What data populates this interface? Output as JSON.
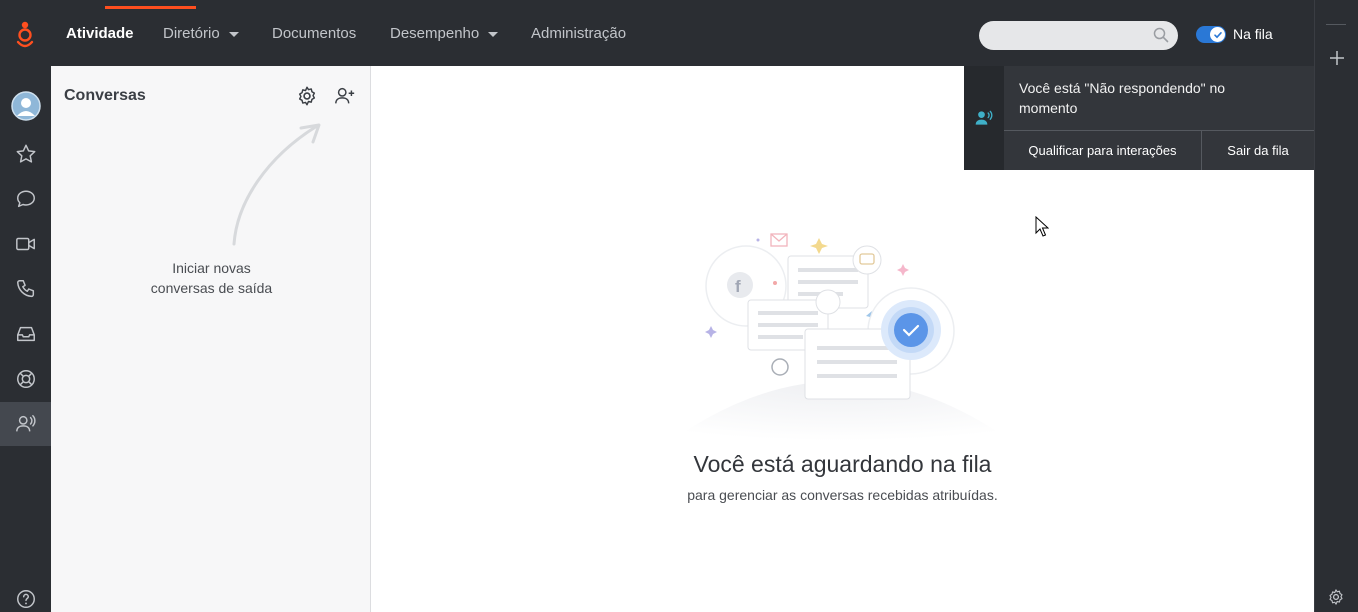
{
  "nav": {
    "items": [
      {
        "label": "Atividade",
        "active": true,
        "dropdown": false
      },
      {
        "label": "Diretório",
        "active": false,
        "dropdown": true
      },
      {
        "label": "Documentos",
        "active": false,
        "dropdown": false
      },
      {
        "label": "Desempenho",
        "active": false,
        "dropdown": true
      },
      {
        "label": "Administração",
        "active": false,
        "dropdown": false
      }
    ],
    "search_placeholder": "",
    "queue_toggle_label": "Na fila"
  },
  "sidebar": {
    "icons": [
      "genesys-logo-icon",
      "avatar-icon",
      "star-icon",
      "chat-icon",
      "video-icon",
      "phone-icon",
      "inbox-icon",
      "lifebuoy-icon",
      "agent-queue-icon",
      "help-icon"
    ]
  },
  "conversations": {
    "title": "Conversas",
    "hint": "Iniciar novas conversas de saída"
  },
  "main": {
    "title": "Você está aguardando na fila",
    "subtitle": "para gerenciar as conversas recebidas atribuídas."
  },
  "notification": {
    "message": "Você está \"Não respondendo\" no momento",
    "qualify_label": "Qualificar para interações",
    "leave_label": "Sair da fila"
  },
  "colors": {
    "accent": "#ff4f1f",
    "toggle": "#2a78d6",
    "dark_bg": "#2b2e33"
  }
}
